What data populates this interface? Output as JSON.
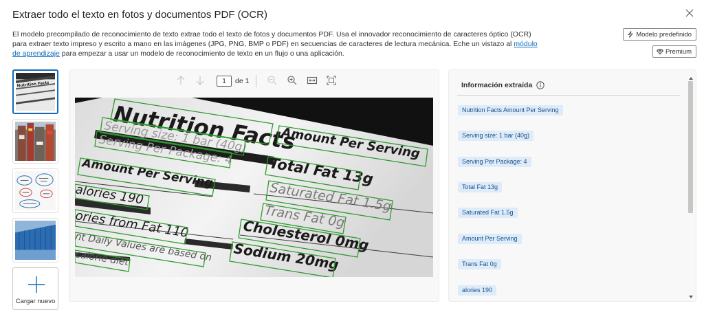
{
  "header": {
    "title": "Extraer todo el texto en fotos y documentos PDF (OCR)",
    "description_1": "El modelo precompilado de reconocimiento de texto extrae todo el texto de fotos y documentos PDF. Usa el innovador reconocimiento de caracteres óptico (OCR) para extraer texto impreso y escrito a mano en las imágenes (JPG, PNG, BMP o PDF) en secuencias de caracteres de lectura mecánica. Eche un vistazo al ",
    "link": "módulo de aprendizaje",
    "description_2": " para empezar a usar un modelo de reconocimiento de texto en un flujo o una aplicación.",
    "model_button": "Modelo predefinido",
    "premium_button": "Premium"
  },
  "thumbnails": {
    "upload_label": "Cargar nuevo",
    "nutrition_mini": "Nutrition Facts"
  },
  "viewer": {
    "page_value": "1",
    "page_of": "de 1"
  },
  "document": {
    "lines": [
      "Nutrition Facts",
      "Serving size: 1 bar (40g)",
      "Serving Per Package: 4",
      "Amount Per Serving",
      "alories 190",
      "ories from Fat 110",
      "nt Daily Values are based on",
      "calorie diet",
      "Amount Per Serving",
      "Total Fat 13g",
      "Saturated Fat 1.5g",
      "Trans Fat 0g",
      "Cholesterol 0mg",
      "Sodium 20mg"
    ]
  },
  "panel": {
    "title": "Información extraída",
    "items": [
      "Nutrition Facts Amount Per Serving",
      "Serving size: 1 bar (40g)",
      "Serving Per Package: 4",
      "Total Fat 13g",
      "Saturated Fat 1.5g",
      "Amount Per Serving",
      "Trans Fat 0g",
      "alories 190"
    ]
  },
  "colors": {
    "accent": "#0f6cbd",
    "ocr_box": "#2e9b2e",
    "tag_bg": "#deecf9",
    "tag_text": "#1b4f8a"
  },
  "icons": {
    "close": "close-icon",
    "model": "lightning-icon",
    "premium": "diamond-icon",
    "up": "arrow-up-icon",
    "down": "arrow-down-icon",
    "zoom_out": "zoom-out-icon",
    "zoom_in": "zoom-in-icon",
    "fit_width": "fit-width-icon",
    "fit_page": "fit-page-icon",
    "info": "info-icon",
    "upload": "plus-icon"
  }
}
